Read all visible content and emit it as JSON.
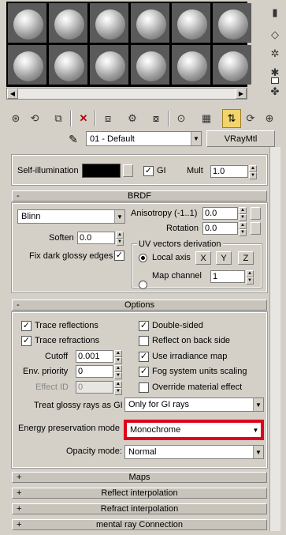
{
  "toolbar": {
    "material_name": "01 - Default",
    "material_type": "VRayMtl",
    "eyedropper_icon": "eyedropper-icon"
  },
  "self_illumination": {
    "label": "Self-illumination",
    "color": "#000000",
    "gi_label": "GI",
    "gi_checked": true,
    "mult_label": "Mult",
    "mult_value": "1.0"
  },
  "brdf": {
    "header": "BRDF",
    "sign": "-",
    "type": "Blinn",
    "anisotropy_label": "Anisotropy (-1..1)",
    "anisotropy_value": "0.0",
    "rotation_label": "Rotation",
    "rotation_value": "0.0",
    "soften_label": "Soften",
    "soften_value": "0.0",
    "fix_dark_label": "Fix dark glossy edges",
    "fix_dark_checked": true,
    "uv_group_label": "UV vectors derivation",
    "local_axis_label": "Local axis",
    "local_axis_selected": true,
    "axis_x": "X",
    "axis_y": "Y",
    "axis_z": "Z",
    "map_channel_label": "Map channel",
    "map_channel_value": "1"
  },
  "options": {
    "header": "Options",
    "sign": "-",
    "trace_reflections": "Trace reflections",
    "trace_refractions": "Trace refractions",
    "cutoff_label": "Cutoff",
    "cutoff_value": "0.001",
    "env_priority_label": "Env. priority",
    "env_priority_value": "0",
    "effect_id_label": "Effect ID",
    "effect_id_value": "0",
    "double_sided": "Double-sided",
    "reflect_back": "Reflect on back side",
    "use_irradiance": "Use irradiance map",
    "fog_units": "Fog system units scaling",
    "override_effect": "Override material effect",
    "glossy_gi_label": "Treat glossy rays as GI",
    "glossy_gi_value": "Only for GI rays",
    "energy_label": "Energy preservation mode",
    "energy_value": "Monochrome",
    "opacity_label": "Opacity mode:",
    "opacity_value": "Normal",
    "highlight_color": "#e0001b"
  },
  "rollouts": [
    {
      "sign": "+",
      "label": "Maps"
    },
    {
      "sign": "+",
      "label": "Reflect interpolation"
    },
    {
      "sign": "+",
      "label": "Refract interpolation"
    },
    {
      "sign": "+",
      "label": "mental ray Connection"
    }
  ]
}
